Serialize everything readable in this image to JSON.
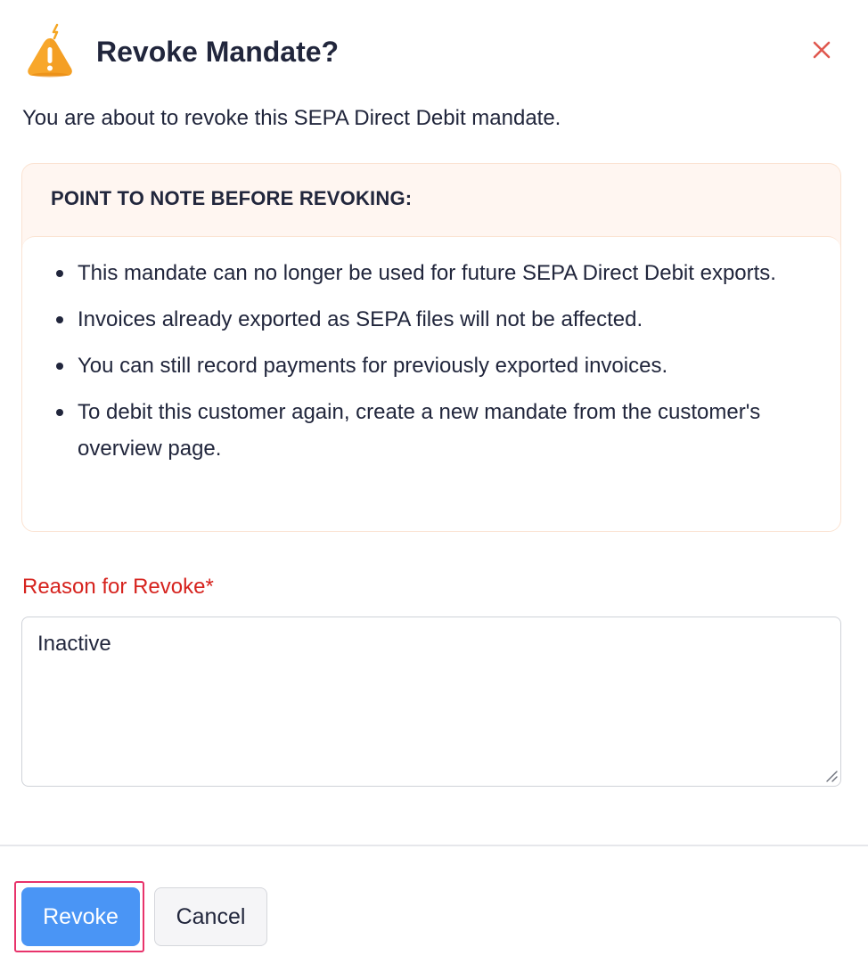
{
  "dialog": {
    "title": "Revoke Mandate?",
    "intro": "You are about to revoke this SEPA Direct Debit mandate.",
    "warning_icon": "warning-triangle-icon",
    "close_icon": "close-icon"
  },
  "note": {
    "heading": "POINT TO NOTE BEFORE REVOKING:",
    "items": [
      "This mandate can no longer be used for future SEPA Direct Debit exports.",
      "Invoices already exported as SEPA files will not be affected.",
      "You can still record payments for previously exported invoices.",
      "To debit this customer again, create a new mandate from the customer's overview page."
    ]
  },
  "reason": {
    "label": "Reason for Revoke*",
    "value": "Inactive"
  },
  "actions": {
    "revoke_label": "Revoke",
    "cancel_label": "Cancel"
  },
  "colors": {
    "primary": "#4a95f5",
    "required_label": "#d6231e",
    "warning": "#f5a623",
    "close": "#e0584f",
    "focus_ring": "#e8336b",
    "note_background": "#fff6f1"
  }
}
